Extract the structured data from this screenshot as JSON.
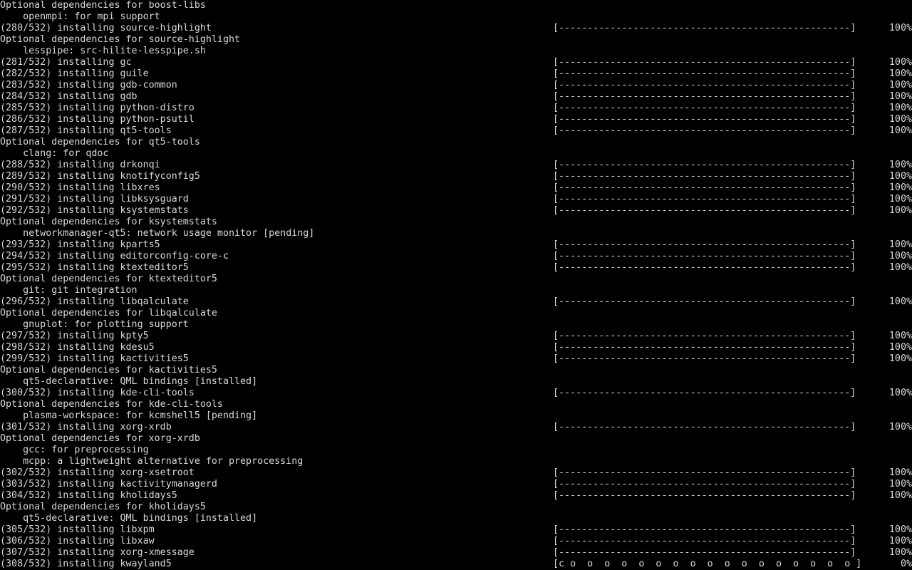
{
  "colors": {
    "background": "#000000",
    "foreground": "#d8d8d8"
  },
  "lines": [
    {
      "text": "Optional dependencies for boost-libs"
    },
    {
      "text": "    openmpi: for mpi support"
    },
    {
      "text": "(280/532) installing source-highlight",
      "bar": "[---------------------------------------------------]",
      "percent": "100%"
    },
    {
      "text": "Optional dependencies for source-highlight"
    },
    {
      "text": "    lesspipe: src-hilite-lesspipe.sh"
    },
    {
      "text": "(281/532) installing gc",
      "bar": "[---------------------------------------------------]",
      "percent": "100%"
    },
    {
      "text": "(282/532) installing guile",
      "bar": "[---------------------------------------------------]",
      "percent": "100%"
    },
    {
      "text": "(283/532) installing gdb-common",
      "bar": "[---------------------------------------------------]",
      "percent": "100%"
    },
    {
      "text": "(284/532) installing gdb",
      "bar": "[---------------------------------------------------]",
      "percent": "100%"
    },
    {
      "text": "(285/532) installing python-distro",
      "bar": "[---------------------------------------------------]",
      "percent": "100%"
    },
    {
      "text": "(286/532) installing python-psutil",
      "bar": "[---------------------------------------------------]",
      "percent": "100%"
    },
    {
      "text": "(287/532) installing qt5-tools",
      "bar": "[---------------------------------------------------]",
      "percent": "100%"
    },
    {
      "text": "Optional dependencies for qt5-tools"
    },
    {
      "text": "    clang: for qdoc"
    },
    {
      "text": "(288/532) installing drkonqi",
      "bar": "[---------------------------------------------------]",
      "percent": "100%"
    },
    {
      "text": "(289/532) installing knotifyconfig5",
      "bar": "[---------------------------------------------------]",
      "percent": "100%"
    },
    {
      "text": "(290/532) installing libxres",
      "bar": "[---------------------------------------------------]",
      "percent": "100%"
    },
    {
      "text": "(291/532) installing libksysguard",
      "bar": "[---------------------------------------------------]",
      "percent": "100%"
    },
    {
      "text": "(292/532) installing ksystemstats",
      "bar": "[---------------------------------------------------]",
      "percent": "100%"
    },
    {
      "text": "Optional dependencies for ksystemstats"
    },
    {
      "text": "    networkmanager-qt5: network usage monitor [pending]"
    },
    {
      "text": "(293/532) installing kparts5",
      "bar": "[---------------------------------------------------]",
      "percent": "100%"
    },
    {
      "text": "(294/532) installing editorconfig-core-c",
      "bar": "[---------------------------------------------------]",
      "percent": "100%"
    },
    {
      "text": "(295/532) installing ktexteditor5",
      "bar": "[---------------------------------------------------]",
      "percent": "100%"
    },
    {
      "text": "Optional dependencies for ktexteditor5"
    },
    {
      "text": "    git: git integration"
    },
    {
      "text": "(296/532) installing libqalculate",
      "bar": "[---------------------------------------------------]",
      "percent": "100%"
    },
    {
      "text": "Optional dependencies for libqalculate"
    },
    {
      "text": "    gnuplot: for plotting support"
    },
    {
      "text": "(297/532) installing kpty5",
      "bar": "[---------------------------------------------------]",
      "percent": "100%"
    },
    {
      "text": "(298/532) installing kdesu5",
      "bar": "[---------------------------------------------------]",
      "percent": "100%"
    },
    {
      "text": "(299/532) installing kactivities5",
      "bar": "[---------------------------------------------------]",
      "percent": "100%"
    },
    {
      "text": "Optional dependencies for kactivities5"
    },
    {
      "text": "    qt5-declarative: QML bindings [installed]"
    },
    {
      "text": "(300/532) installing kde-cli-tools",
      "bar": "[---------------------------------------------------]",
      "percent": "100%"
    },
    {
      "text": "Optional dependencies for kde-cli-tools"
    },
    {
      "text": "    plasma-workspace: for kcmshell5 [pending]"
    },
    {
      "text": "(301/532) installing xorg-xrdb",
      "bar": "[---------------------------------------------------]",
      "percent": "100%"
    },
    {
      "text": "Optional dependencies for xorg-xrdb"
    },
    {
      "text": "    gcc: for preprocessing"
    },
    {
      "text": "    mcpp: a lightweight alternative for preprocessing"
    },
    {
      "text": "(302/532) installing xorg-xsetroot",
      "bar": "[---------------------------------------------------]",
      "percent": "100%"
    },
    {
      "text": "(303/532) installing kactivitymanagerd",
      "bar": "[---------------------------------------------------]",
      "percent": "100%"
    },
    {
      "text": "(304/532) installing kholidays5",
      "bar": "[---------------------------------------------------]",
      "percent": "100%"
    },
    {
      "text": "Optional dependencies for kholidays5"
    },
    {
      "text": "    qt5-declarative: QML bindings [installed]"
    },
    {
      "text": "(305/532) installing libxpm",
      "bar": "[---------------------------------------------------]",
      "percent": "100%"
    },
    {
      "text": "(306/532) installing libxaw",
      "bar": "[---------------------------------------------------]",
      "percent": "100%"
    },
    {
      "text": "(307/532) installing xorg-xmessage",
      "bar": "[---------------------------------------------------]",
      "percent": "100%"
    },
    {
      "text": "(308/532) installing kwayland5",
      "bar": "[c o  o  o  o  o  o  o  o  o  o  o  o  o  o  o  o  o ]",
      "percent": "0%"
    }
  ]
}
